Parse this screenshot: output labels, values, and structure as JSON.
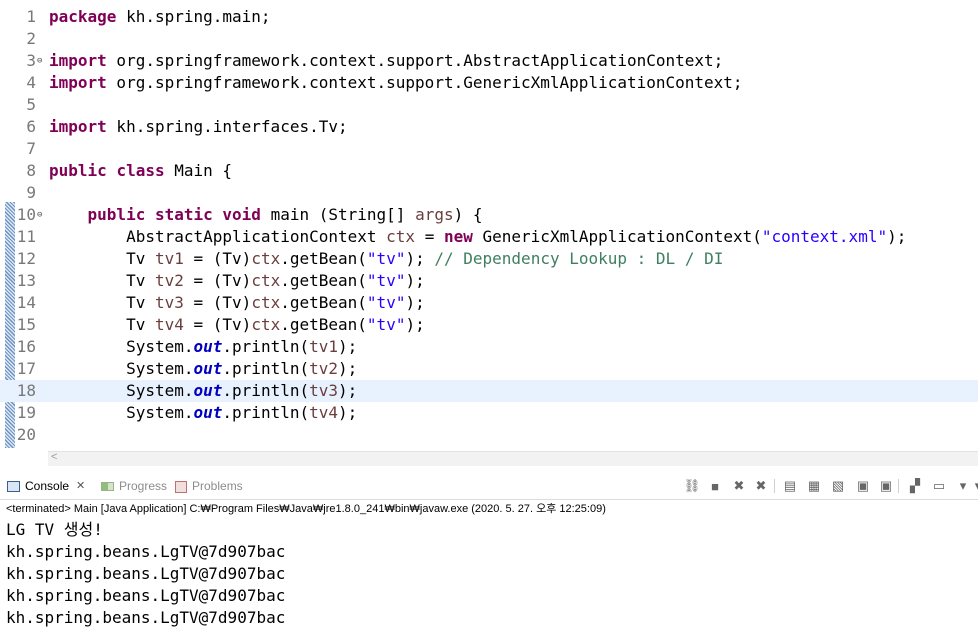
{
  "editor": {
    "lines": [
      {
        "n": "1",
        "tokens": [
          {
            "t": "package",
            "c": "kw"
          },
          {
            "t": " kh.spring.main;"
          }
        ]
      },
      {
        "n": "2",
        "tokens": []
      },
      {
        "n": "3",
        "fold": "⊖",
        "tokens": [
          {
            "t": "import",
            "c": "kw"
          },
          {
            "t": " org.springframework.context.support.AbstractApplicationContext;"
          }
        ]
      },
      {
        "n": "4",
        "tokens": [
          {
            "t": "import",
            "c": "kw"
          },
          {
            "t": " org.springframework.context.support.GenericXmlApplicationContext;"
          }
        ]
      },
      {
        "n": "5",
        "tokens": []
      },
      {
        "n": "6",
        "tokens": [
          {
            "t": "import",
            "c": "kw"
          },
          {
            "t": " kh.spring.interfaces.Tv;"
          }
        ]
      },
      {
        "n": "7",
        "tokens": []
      },
      {
        "n": "8",
        "tokens": [
          {
            "t": "public",
            "c": "kw"
          },
          {
            "t": " "
          },
          {
            "t": "class",
            "c": "kw"
          },
          {
            "t": " Main {"
          }
        ]
      },
      {
        "n": "9",
        "tokens": []
      },
      {
        "n": "10",
        "fold": "⊖",
        "tokens": [
          {
            "t": "    "
          },
          {
            "t": "public",
            "c": "kw"
          },
          {
            "t": " "
          },
          {
            "t": "static",
            "c": "kw"
          },
          {
            "t": " "
          },
          {
            "t": "void",
            "c": "kw"
          },
          {
            "t": " main (String[] "
          },
          {
            "t": "args",
            "c": "var"
          },
          {
            "t": ") {"
          }
        ]
      },
      {
        "n": "11",
        "tokens": [
          {
            "t": "        AbstractApplicationContext "
          },
          {
            "t": "ctx",
            "c": "var"
          },
          {
            "t": " = "
          },
          {
            "t": "new",
            "c": "kw"
          },
          {
            "t": " GenericXmlApplicationContext("
          },
          {
            "t": "\"context.xml\"",
            "c": "str"
          },
          {
            "t": ");"
          }
        ]
      },
      {
        "n": "12",
        "tokens": [
          {
            "t": "        Tv "
          },
          {
            "t": "tv1",
            "c": "var"
          },
          {
            "t": " = (Tv)"
          },
          {
            "t": "ctx",
            "c": "var"
          },
          {
            "t": ".getBean("
          },
          {
            "t": "\"tv\"",
            "c": "str"
          },
          {
            "t": "); "
          },
          {
            "t": "// Dependency Lookup : DL / DI",
            "c": "cm"
          }
        ]
      },
      {
        "n": "13",
        "tokens": [
          {
            "t": "        Tv "
          },
          {
            "t": "tv2",
            "c": "var"
          },
          {
            "t": " = (Tv)"
          },
          {
            "t": "ctx",
            "c": "var"
          },
          {
            "t": ".getBean("
          },
          {
            "t": "\"tv\"",
            "c": "str"
          },
          {
            "t": ");"
          }
        ]
      },
      {
        "n": "14",
        "tokens": [
          {
            "t": "        Tv "
          },
          {
            "t": "tv3",
            "c": "var"
          },
          {
            "t": " = (Tv)"
          },
          {
            "t": "ctx",
            "c": "var"
          },
          {
            "t": ".getBean("
          },
          {
            "t": "\"tv\"",
            "c": "str"
          },
          {
            "t": ");"
          }
        ]
      },
      {
        "n": "15",
        "tokens": [
          {
            "t": "        Tv "
          },
          {
            "t": "tv4",
            "c": "var"
          },
          {
            "t": " = (Tv)"
          },
          {
            "t": "ctx",
            "c": "var"
          },
          {
            "t": ".getBean("
          },
          {
            "t": "\"tv\"",
            "c": "str"
          },
          {
            "t": ");"
          }
        ]
      },
      {
        "n": "16",
        "tokens": [
          {
            "t": "        System."
          },
          {
            "t": "out",
            "c": "fld"
          },
          {
            "t": ".println("
          },
          {
            "t": "tv1",
            "c": "var"
          },
          {
            "t": ");"
          }
        ]
      },
      {
        "n": "17",
        "tokens": [
          {
            "t": "        System."
          },
          {
            "t": "out",
            "c": "fld"
          },
          {
            "t": ".println("
          },
          {
            "t": "tv2",
            "c": "var"
          },
          {
            "t": ");"
          }
        ]
      },
      {
        "n": "18",
        "current": true,
        "tokens": [
          {
            "t": "        System."
          },
          {
            "t": "out",
            "c": "fld"
          },
          {
            "t": ".println("
          },
          {
            "t": "tv3",
            "c": "var"
          },
          {
            "t": ");"
          }
        ]
      },
      {
        "n": "19",
        "tokens": [
          {
            "t": "        System."
          },
          {
            "t": "out",
            "c": "fld"
          },
          {
            "t": ".println("
          },
          {
            "t": "tv4",
            "c": "var"
          },
          {
            "t": ");"
          }
        ]
      },
      {
        "n": "20",
        "tokens": []
      }
    ],
    "scroll_left_arrow": "<"
  },
  "views": {
    "console_tab": "Console",
    "console_close": "✕",
    "progress_tab": "Progress",
    "problems_tab": "Problems"
  },
  "toolbar": {
    "buttons": [
      "link-icon",
      "terminate-icon",
      "remove-launch-icon",
      "remove-all-terminated-icon",
      "scroll-lock-icon",
      "word-wrap-icon",
      "clear-console-icon",
      "show-on-stdout-icon",
      "show-on-stderr-icon",
      "pin-console-icon",
      "display-selected-console-icon",
      "open-console-icon",
      "view-menu-icon"
    ]
  },
  "console": {
    "status": "<terminated> Main [Java Application] C:₩Program Files₩Java₩jre1.8.0_241₩bin₩javaw.exe (2020. 5. 27. 오후 12:25:09)",
    "output": [
      "LG TV 생성!",
      "kh.spring.beans.LgTV@7d907bac",
      "kh.spring.beans.LgTV@7d907bac",
      "kh.spring.beans.LgTV@7d907bac",
      "kh.spring.beans.LgTV@7d907bac"
    ]
  },
  "colors": {
    "keyword": "#7f0055",
    "string": "#2a00ff",
    "comment": "#3f7f5f",
    "variable": "#6a3e3e",
    "field": "#0000c0",
    "current_line": "#e8f2fe"
  }
}
